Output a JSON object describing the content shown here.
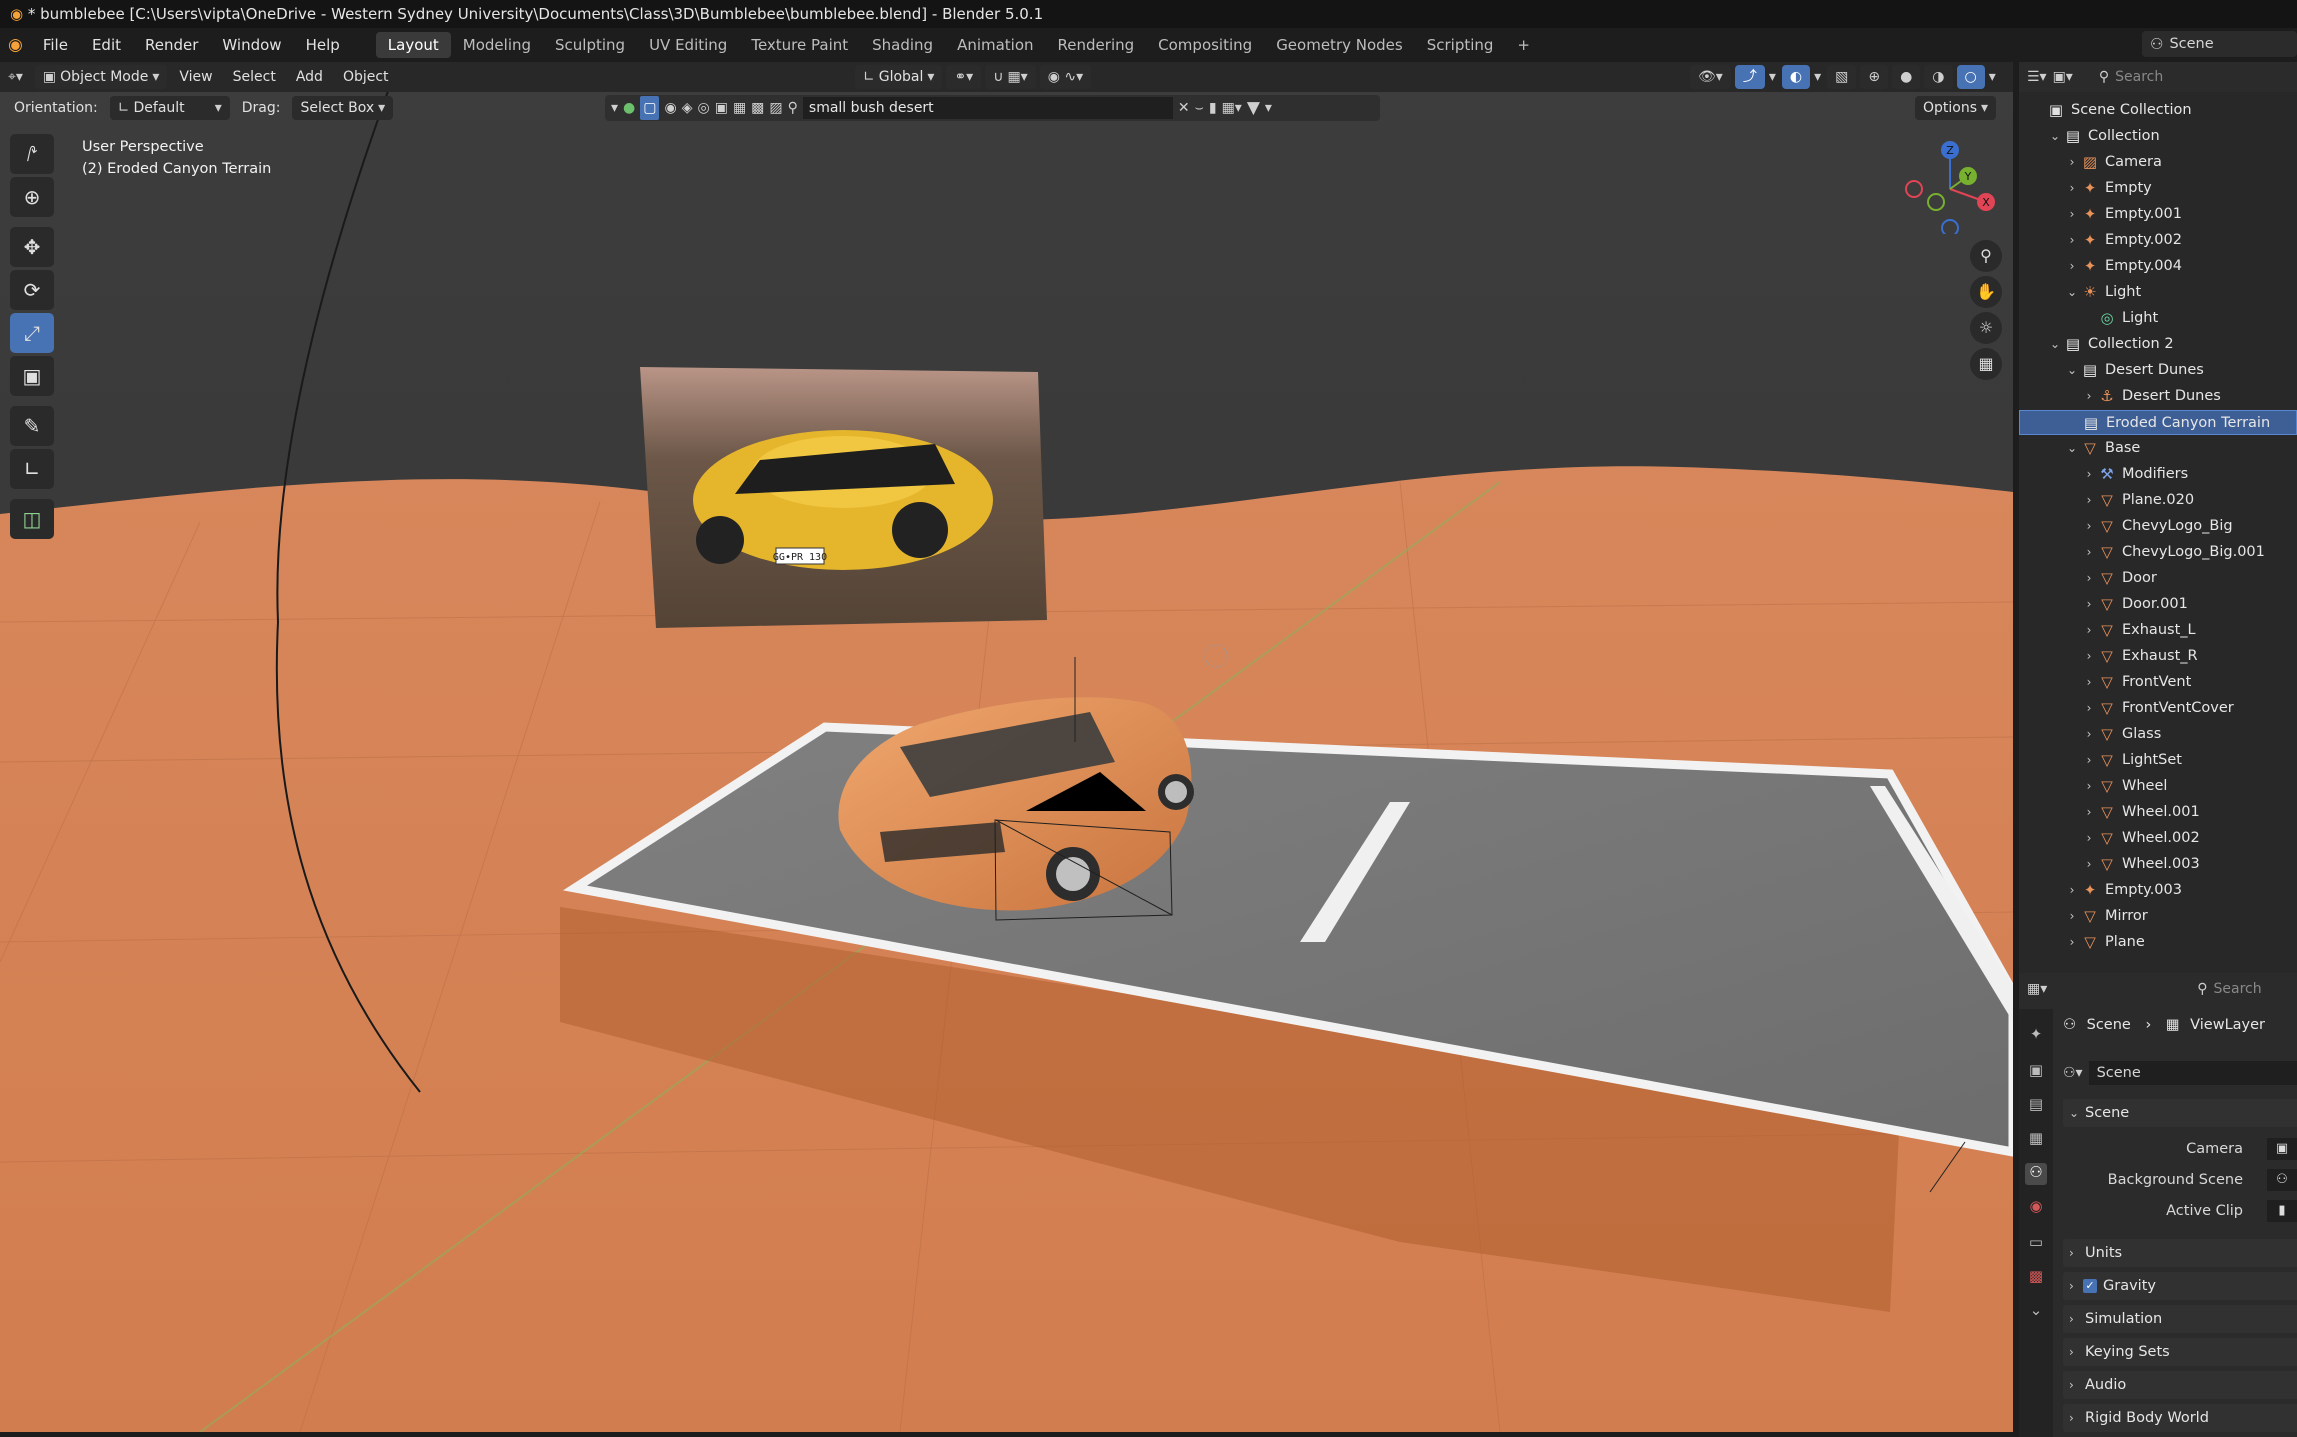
{
  "window": {
    "title": "* bumblebee [C:\\Users\\vipta\\OneDrive - Western Sydney University\\Documents\\Class\\3D\\Bumblebee\\bumblebee.blend] - Blender 5.0.1"
  },
  "menu": [
    "File",
    "Edit",
    "Render",
    "Window",
    "Help"
  ],
  "workspaces": [
    "Layout",
    "Modeling",
    "Sculpting",
    "UV Editing",
    "Texture Paint",
    "Shading",
    "Animation",
    "Rendering",
    "Compositing",
    "Geometry Nodes",
    "Scripting"
  ],
  "scene_selector": "Scene",
  "viewport": {
    "mode": "Object Mode",
    "menus": [
      "View",
      "Select",
      "Add",
      "Object"
    ],
    "transform": "Global",
    "orientation_label": "Orientation:",
    "orientation_value": "Default",
    "drag_label": "Drag:",
    "drag_value": "Select Box",
    "search_value": "small bush desert",
    "options": "Options",
    "overlay_line1": "User Perspective",
    "overlay_line2": "(2) Eroded Canyon Terrain",
    "license_plate": "GG•PR 130"
  },
  "gizmo": {
    "x": "X",
    "y": "Y",
    "z": "Z"
  },
  "outliner": {
    "search_placeholder": "Search",
    "rows": [
      {
        "label": "Scene Collection",
        "indent": 0,
        "icon": "scene-collection-icon",
        "chev": ""
      },
      {
        "label": "Collection",
        "indent": 1,
        "icon": "collection-icon",
        "chev": "v"
      },
      {
        "label": "Camera",
        "indent": 2,
        "icon": "camera-icon",
        "chev": ">"
      },
      {
        "label": "Empty",
        "indent": 2,
        "icon": "empty-icon",
        "chev": ">"
      },
      {
        "label": "Empty.001",
        "indent": 2,
        "icon": "empty-icon",
        "chev": ">"
      },
      {
        "label": "Empty.002",
        "indent": 2,
        "icon": "empty-icon",
        "chev": ">"
      },
      {
        "label": "Empty.004",
        "indent": 2,
        "icon": "empty-icon",
        "chev": ">"
      },
      {
        "label": "Light",
        "indent": 2,
        "icon": "light-icon",
        "chev": "v"
      },
      {
        "label": "Light",
        "indent": 3,
        "icon": "light-data-icon",
        "chev": ""
      },
      {
        "label": "Collection 2",
        "indent": 1,
        "icon": "collection-icon",
        "chev": "v"
      },
      {
        "label": "Desert Dunes",
        "indent": 2,
        "icon": "collection-icon",
        "chev": "v"
      },
      {
        "label": "Desert Dunes",
        "indent": 3,
        "icon": "armature-icon",
        "chev": ">"
      },
      {
        "label": "Eroded Canyon Terrain",
        "indent": 2,
        "icon": "collection-icon",
        "chev": ""
      },
      {
        "label": "Base",
        "indent": 2,
        "icon": "mesh-icon",
        "chev": "v"
      },
      {
        "label": "Modifiers",
        "indent": 3,
        "icon": "wrench-icon",
        "chev": ">"
      },
      {
        "label": "Plane.020",
        "indent": 3,
        "icon": "mesh-icon",
        "chev": ">"
      },
      {
        "label": "ChevyLogo_Big",
        "indent": 3,
        "icon": "mesh-icon",
        "chev": ">"
      },
      {
        "label": "ChevyLogo_Big.001",
        "indent": 3,
        "icon": "mesh-icon",
        "chev": ">"
      },
      {
        "label": "Door",
        "indent": 3,
        "icon": "mesh-icon",
        "chev": ">"
      },
      {
        "label": "Door.001",
        "indent": 3,
        "icon": "mesh-icon",
        "chev": ">"
      },
      {
        "label": "Exhaust_L",
        "indent": 3,
        "icon": "mesh-icon",
        "chev": ">"
      },
      {
        "label": "Exhaust_R",
        "indent": 3,
        "icon": "mesh-icon",
        "chev": ">"
      },
      {
        "label": "FrontVent",
        "indent": 3,
        "icon": "mesh-icon",
        "chev": ">"
      },
      {
        "label": "FrontVentCover",
        "indent": 3,
        "icon": "mesh-icon",
        "chev": ">"
      },
      {
        "label": "Glass",
        "indent": 3,
        "icon": "mesh-icon",
        "chev": ">"
      },
      {
        "label": "LightSet",
        "indent": 3,
        "icon": "mesh-icon",
        "chev": ">"
      },
      {
        "label": "Wheel",
        "indent": 3,
        "icon": "mesh-icon",
        "chev": ">"
      },
      {
        "label": "Wheel.001",
        "indent": 3,
        "icon": "mesh-icon",
        "chev": ">"
      },
      {
        "label": "Wheel.002",
        "indent": 3,
        "icon": "mesh-icon",
        "chev": ">"
      },
      {
        "label": "Wheel.003",
        "indent": 3,
        "icon": "mesh-icon",
        "chev": ">"
      },
      {
        "label": "Empty.003",
        "indent": 2,
        "icon": "empty-icon",
        "chev": ">"
      },
      {
        "label": "Mirror",
        "indent": 2,
        "icon": "mesh-icon",
        "chev": ">"
      },
      {
        "label": "Plane",
        "indent": 2,
        "icon": "mesh-icon",
        "chev": ">"
      }
    ]
  },
  "properties": {
    "search_placeholder": "Search",
    "breadcrumb": [
      "Scene",
      "ViewLayer"
    ],
    "datablock": "Scene",
    "panel_title": "Scene",
    "fields": [
      "Camera",
      "Background Scene",
      "Active Clip"
    ],
    "subpanels": [
      "Units",
      "Gravity",
      "Simulation",
      "Keying Sets",
      "Audio",
      "Rigid Body World"
    ],
    "gravity_enabled": true
  },
  "colors": {
    "accent": "#4772b3",
    "terrain": "#d88456",
    "selected_row": "#3e5f96",
    "mesh_icon": "#e8925a",
    "collection_icon": "#ededed"
  }
}
